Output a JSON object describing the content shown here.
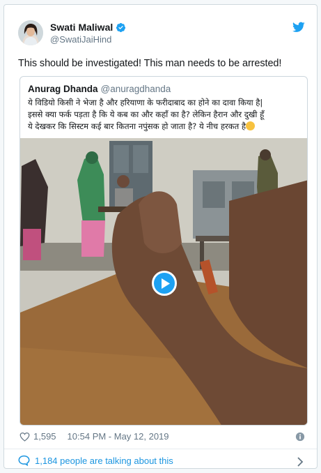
{
  "tweet": {
    "author_name": "Swati Maliwal",
    "author_handle": "@SwatiJaiHind",
    "text": "This should be investigated! This man needs to be arrested!",
    "likes": "1,595",
    "timestamp": "10:54 PM - May 12, 2019",
    "talking": "1,184 people are talking about this"
  },
  "quoted": {
    "author_name": "Anurag Dhanda",
    "author_handle": "@anuragdhanda",
    "text_line_1": "ये विडियो किसी ने भेजा है और हरियाणा के फरीदाबाद का होने का दावा किया है|",
    "text_line_2": "इससे क्या फर्क पड़ता है कि ये कब का और कहाँ का है? लेकिन हैरान और दुखी हूँ",
    "text_line_3": "ये देखकर कि सिस्टम कई बार कितना नपुंसक हो जाता है? ये नीच हरकत है"
  },
  "icons": {
    "verified": "verified-badge-icon",
    "brand": "twitter-bird-icon",
    "play": "play-icon",
    "like": "heart-icon",
    "info": "info-icon",
    "conversation": "speech-bubble-icon",
    "chevron": "chevron-right-icon"
  },
  "colors": {
    "accent": "#1da1f2",
    "link": "#1b95e0",
    "muted": "#657786"
  }
}
